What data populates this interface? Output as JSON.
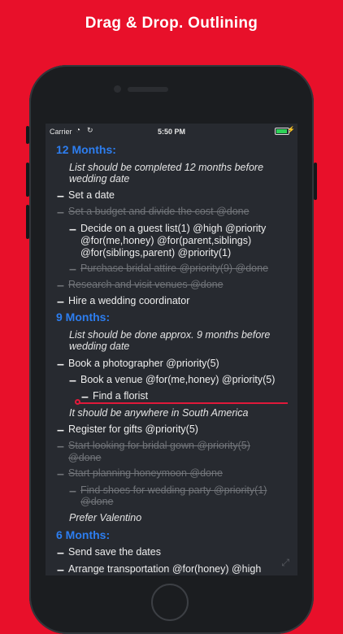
{
  "promo": {
    "headline": "Drag & Drop. Outlining"
  },
  "status_bar": {
    "carrier": "Carrier",
    "time": "5:50 PM"
  },
  "outline": {
    "heading_12": "12 Months:",
    "note_12_l1": "List should be completed 12 months before",
    "note_12_l2": "wedding date",
    "item_set_date": "Set a date",
    "item_budget": "Set a budget and divide the cost @done",
    "item_guest_l1": "Decide on a guest list(1) @high @priority",
    "item_guest_l2": "@for(me,honey) @for(parent,siblings)",
    "item_guest_l3": "@for(siblings,parent) @priority(1)",
    "item_attire": "Purchase bridal attire @priority(9) @done",
    "item_research": "Research and visit venues @done",
    "item_coordinator": "Hire a wedding coordinator",
    "heading_9": "9 Months:",
    "note_9_l1": "List should be done approx. 9 months before",
    "note_9_l2": "wedding date",
    "item_photographer": "Book a photographer @priority(5)",
    "item_venue": "Book a venue @for(me,honey) @priority(5)",
    "item_florist": "Find a florist",
    "note_south_america": "It should be anywhere in South America",
    "item_gifts": "Register for gifts @priority(5)",
    "item_gown_l1": "Start looking for bridal gown @priority(5)",
    "item_gown_l2": "@done",
    "item_honeymoon": "Start planning honeymoon @done",
    "item_shoes_l1": "Find shoes for wedding party @priority(1)",
    "item_shoes_l2": "@done",
    "note_valentino": "Prefer Valentino",
    "heading_6": "6 Months:",
    "item_save_dates": "Send save the dates",
    "item_transport": "Arrange transportation @for(honey) @high"
  },
  "colors": {
    "background": "#e8102a",
    "heading": "#2d7ef0",
    "drop_indicator": "#e0193a",
    "done_text": "#717479"
  },
  "icons": [
    "wifi-icon",
    "sync-icon",
    "battery-icon",
    "expand-icon"
  ]
}
